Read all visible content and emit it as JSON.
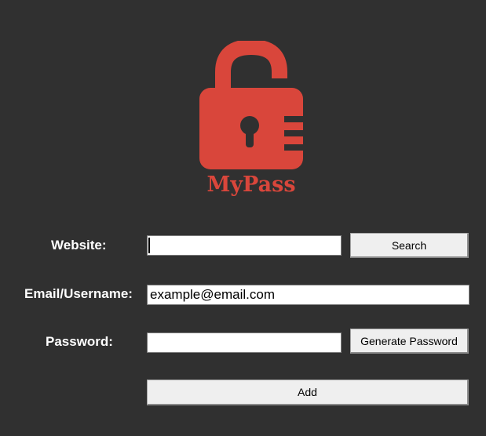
{
  "app": {
    "logo_text": "MyPass",
    "accent_color": "#d9463b",
    "background_color": "#303030",
    "logo_icon": "padlock-icon"
  },
  "form": {
    "website_label": "Website:",
    "website_value": "",
    "search_button": "Search",
    "email_label": "Email/Username:",
    "email_value": "example@email.com",
    "password_label": "Password:",
    "password_value": "",
    "generate_button": "Generate Password",
    "add_button": "Add"
  }
}
